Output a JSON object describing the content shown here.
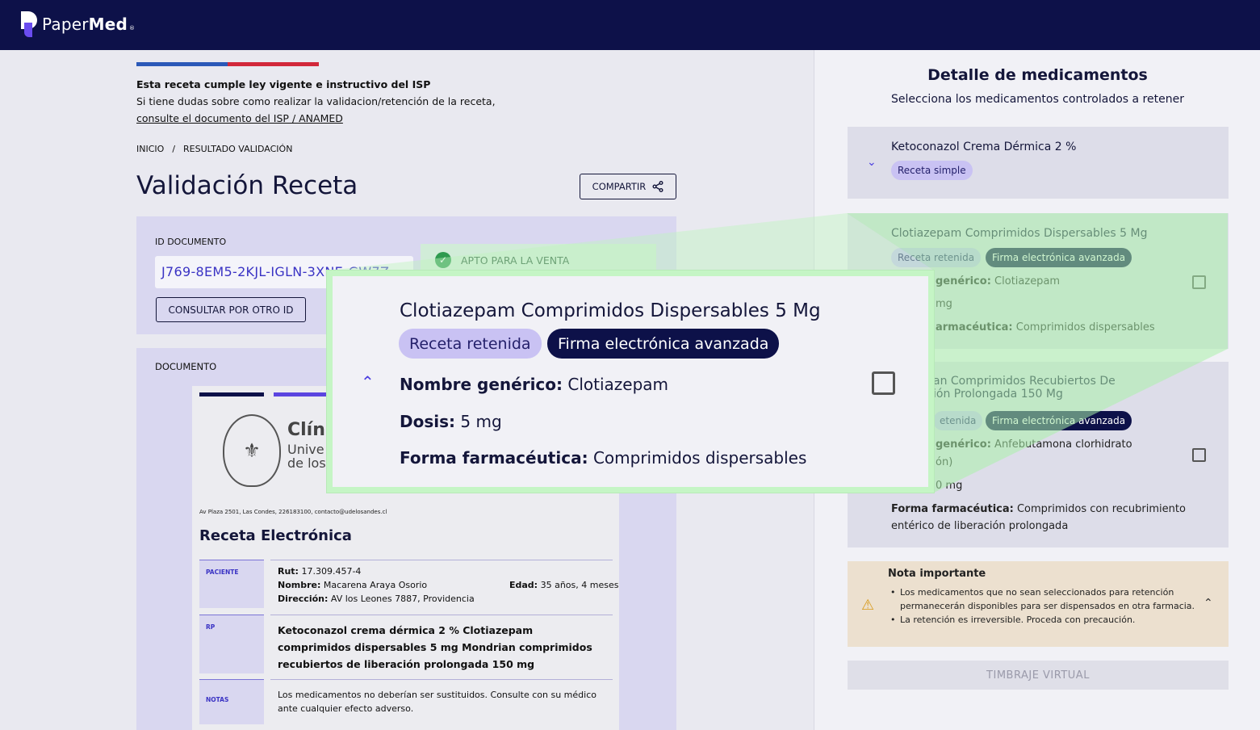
{
  "header": {
    "logo_light": "Paper",
    "logo_bold": "Med",
    "logo_mark": "®"
  },
  "notice": {
    "title": "Esta receta cumple ley vigente e instructivo del ISP",
    "text": "Si tiene dudas sobre como realizar la validacion/retención de la receta,",
    "link": "consulte el documento del ISP / ANAMED"
  },
  "breadcrumb": {
    "home": "INICIO",
    "separator": "/",
    "current": "RESULTADO VALIDACIÓN"
  },
  "page_title": "Validación Receta",
  "share_label": "COMPARTIR",
  "id_section": {
    "label": "ID DOCUMENTO",
    "value": "J769-8EM5-2KJL-IGLN-3XNE-GW7Z",
    "other_id_label": "CONSULTAR POR OTRO ID",
    "status": "APTO PARA LA VENTA"
  },
  "document": {
    "label": "DOCUMENTO",
    "clinic_name": "Clín",
    "clinic_sub1": "Unive",
    "clinic_sub2": "de los",
    "address": "Av Plaza 2501, Las Condes, 226183100, contacto@udelosandes.cl",
    "title": "Receta Electrónica",
    "patient_label": "PACIENTE",
    "rut_label": "Rut:",
    "rut": "17.309.457-4",
    "name_label": "Nombre:",
    "name": "Macarena Araya Osorio",
    "age_label": "Edad:",
    "age": "35 años, 4 meses",
    "address_label": "Dirección:",
    "patient_address": "AV los Leones 7887, Providencia",
    "rp_label": "RP",
    "rp_text": "Ketoconazol crema dérmica 2 % Clotiazepam comprimidos dispersables 5 mg Mondrian comprimidos recubiertos de liberación prolongada 150 mg",
    "notes_label": "NOTAS",
    "notes_text": "Los medicamentos no deberían ser sustituidos. Consulte con su médico ante cualquier efecto adverso."
  },
  "panel": {
    "title": "Detalle de medicamentos",
    "subtitle": "Selecciona los medicamentos controlados a retener",
    "generic_label": "genérico:",
    "pharma_label": "armacéutica:",
    "meds": [
      {
        "name": "Ketoconazol Crema Dérmica 2 %",
        "badge1": "Receta simple"
      },
      {
        "name": "Clotiazepam Comprimidos Dispersables 5 Mg",
        "badge1": "Receta retenida",
        "badge2": "Firma electrónica avanzada",
        "generic": "Clotiazepam",
        "dose": "mg",
        "form": "Comprimidos dispersables"
      },
      {
        "name_line1": "an Comprimidos Recubiertos De",
        "name_line2": "ión Prolongada 150 Mg",
        "badge1": "etenida",
        "badge2": "Firma electrónica avanzada",
        "generic": "Anfebutamona clorhidrato",
        "generic_cont": "ón)",
        "dose": "0 mg",
        "form_label": "Forma farmacéutica:",
        "form_line1": "Comprimidos con recubrimiento",
        "form_line2": "entérico de liberación prolongada"
      }
    ],
    "note": {
      "title": "Nota importante",
      "items": [
        "Los medicamentos que no sean seleccionados para retención permanecerán disponibles para ser dispensados en otra farmacia.",
        "La retención es irreversible. Proceda con precaución."
      ]
    },
    "stamp_button": "TIMBRAJE VIRTUAL"
  },
  "zoom": {
    "name": "Clotiazepam Comprimidos Dispersables 5 Mg",
    "badge1": "Receta retenida",
    "badge2": "Firma electrónica avanzada",
    "generic_label": "Nombre genérico:",
    "generic": "Clotiazepam",
    "dose_label": "Dosis:",
    "dose": "5 mg",
    "form_label": "Forma farmacéutica:",
    "form": "Comprimidos dispersables"
  },
  "colors": {
    "navy": "#0d1149",
    "accent": "#4b3ee0",
    "success": "#2f9a4f",
    "highlight": "#c5f5c5"
  }
}
